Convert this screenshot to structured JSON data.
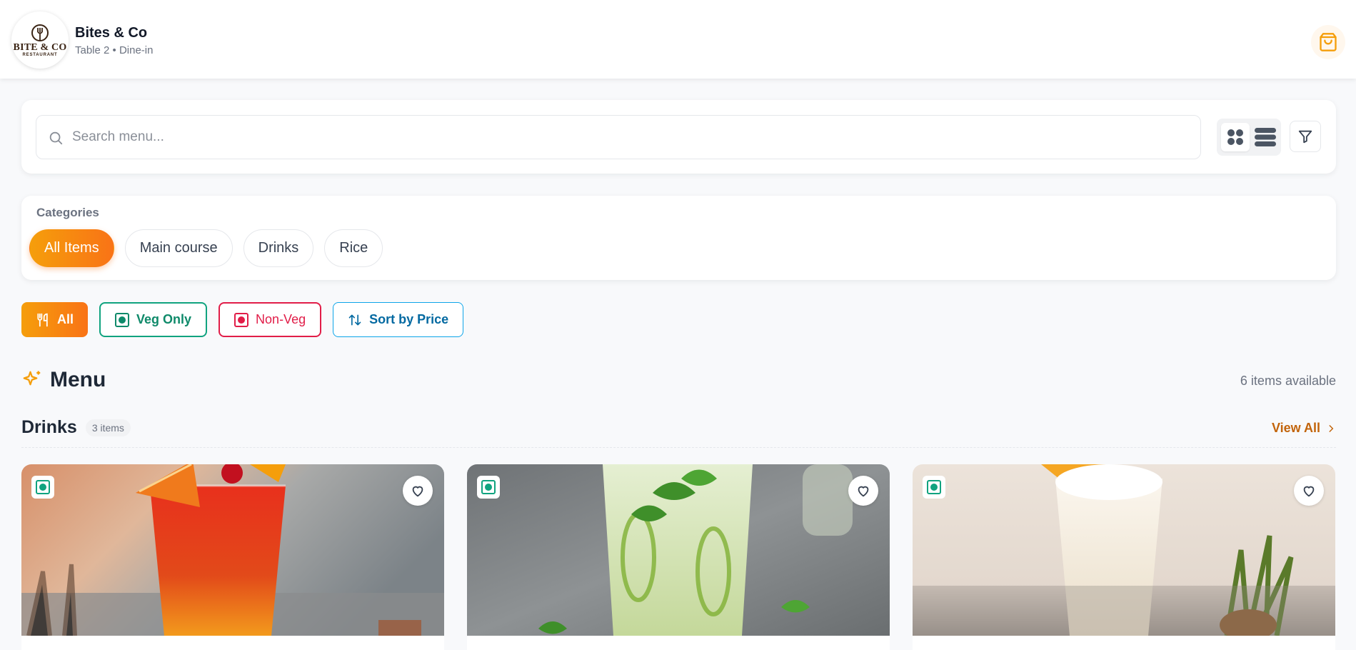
{
  "header": {
    "logo_text": "BITE & CO",
    "logo_subtext": "RESTAURANT",
    "title": "Bites & Co",
    "subtitle": "Table 2 • Dine-in"
  },
  "search": {
    "placeholder": "Search menu..."
  },
  "categories": {
    "label": "Categories",
    "items": [
      "All Items",
      "Main course",
      "Drinks",
      "Rice"
    ],
    "selected": "All Items"
  },
  "filters": {
    "all": "All",
    "veg": "Veg Only",
    "nonveg": "Non-Veg",
    "sort": "Sort by Price"
  },
  "menu": {
    "title": "Menu",
    "available": "6 items available"
  },
  "section": {
    "title": "Drinks",
    "count": "3 items",
    "view_all": "View All"
  },
  "cards": [
    {
      "image": "red sunset cocktail with orange slice and cherry",
      "veg": true
    },
    {
      "image": "mint mojito with lime slices",
      "veg": true
    },
    {
      "image": "creamy pina colada with pineapple",
      "veg": true
    }
  ],
  "colors": {
    "accent_start": "#f59e0b",
    "accent_end": "#f97316",
    "veg": "#10a37f",
    "nonveg": "#e11d48",
    "sort": "#0ea5e9",
    "link": "#c2640b"
  },
  "icons": [
    "fork-icon",
    "shopping-bag-icon",
    "search-icon",
    "grid-view-icon",
    "list-view-icon",
    "filter-icon",
    "utensils-icon",
    "veg-indicator-icon",
    "nonveg-indicator-icon",
    "sort-arrows-icon",
    "sparkles-icon",
    "chevron-right-icon",
    "heart-icon"
  ]
}
